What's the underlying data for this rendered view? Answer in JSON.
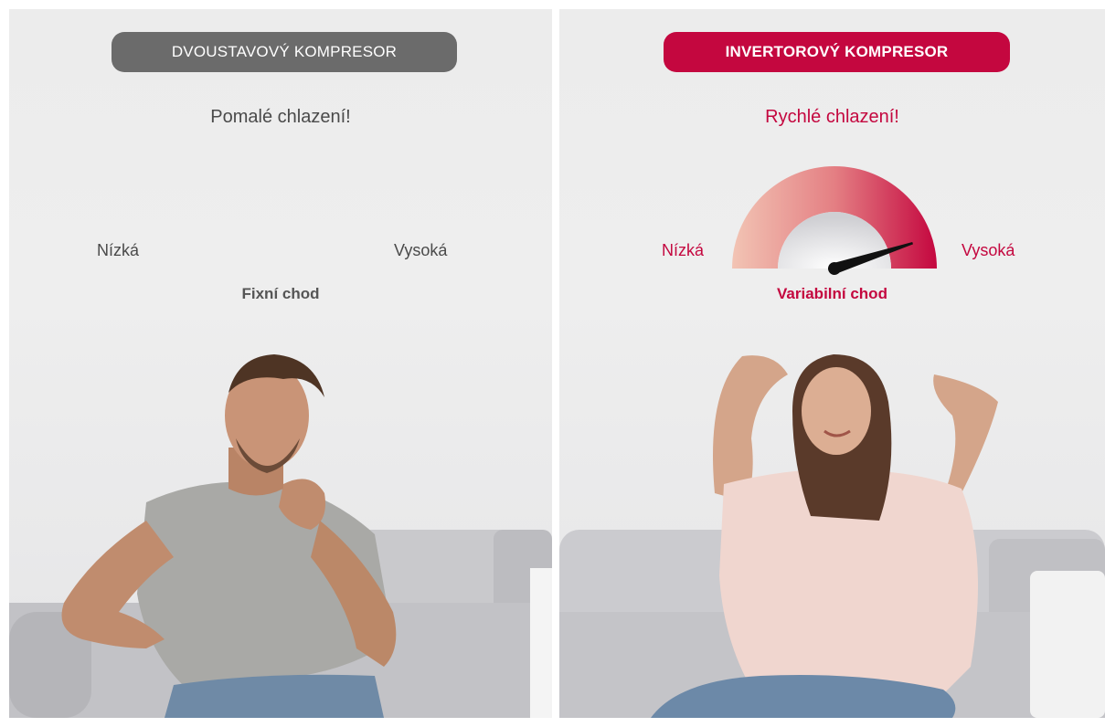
{
  "left_panel": {
    "badge": "DVOUSTAVOVÝ KOMPRESOR",
    "headline": "Pomalé chlazení!",
    "low_label": "Nízká",
    "high_label": "Vysoká",
    "mode": "Fixní chod"
  },
  "right_panel": {
    "badge": "INVERTOROVÝ KOMPRESOR",
    "headline": "Rychlé chlazení!",
    "low_label": "Nízká",
    "high_label": "Vysoká",
    "mode": "Variabilní chod",
    "gauge_level": 0.9
  },
  "colors": {
    "accent": "#c4073f",
    "neutral_badge": "#6b6b6b"
  }
}
